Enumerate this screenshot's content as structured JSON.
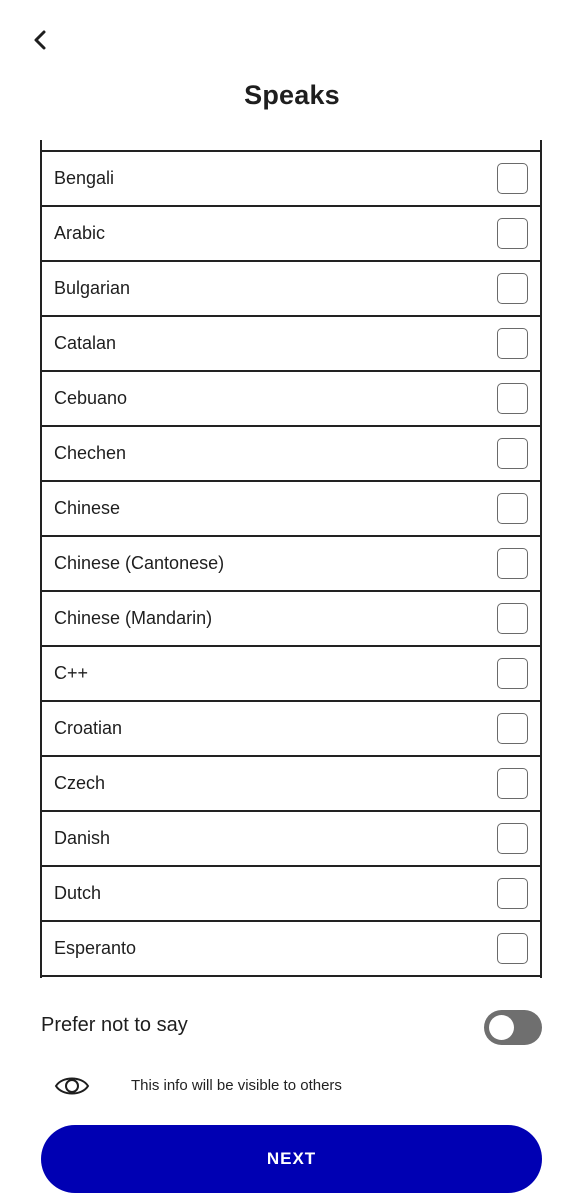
{
  "header": {
    "back_icon": "chevron-left-icon",
    "title": "Speaks"
  },
  "languages": [
    {
      "label": "Bengali",
      "checked": false
    },
    {
      "label": "Arabic",
      "checked": false
    },
    {
      "label": "Bulgarian",
      "checked": false
    },
    {
      "label": "Catalan",
      "checked": false
    },
    {
      "label": "Cebuano",
      "checked": false
    },
    {
      "label": "Chechen",
      "checked": false
    },
    {
      "label": "Chinese",
      "checked": false
    },
    {
      "label": "Chinese (Cantonese)",
      "checked": false
    },
    {
      "label": "Chinese (Mandarin)",
      "checked": false
    },
    {
      "label": "C++",
      "checked": false
    },
    {
      "label": "Croatian",
      "checked": false
    },
    {
      "label": "Czech",
      "checked": false
    },
    {
      "label": "Danish",
      "checked": false
    },
    {
      "label": "Dutch",
      "checked": false
    },
    {
      "label": "Esperanto",
      "checked": false
    }
  ],
  "prefer_not_to_say": {
    "label": "Prefer not to say",
    "enabled": false
  },
  "visibility": {
    "icon": "eye-icon",
    "text": "This info will be visible to others"
  },
  "next_button": {
    "label": "NEXT"
  },
  "colors": {
    "primary": "#0000b3",
    "toggle_off": "#6f6f6f",
    "border": "#222222"
  }
}
